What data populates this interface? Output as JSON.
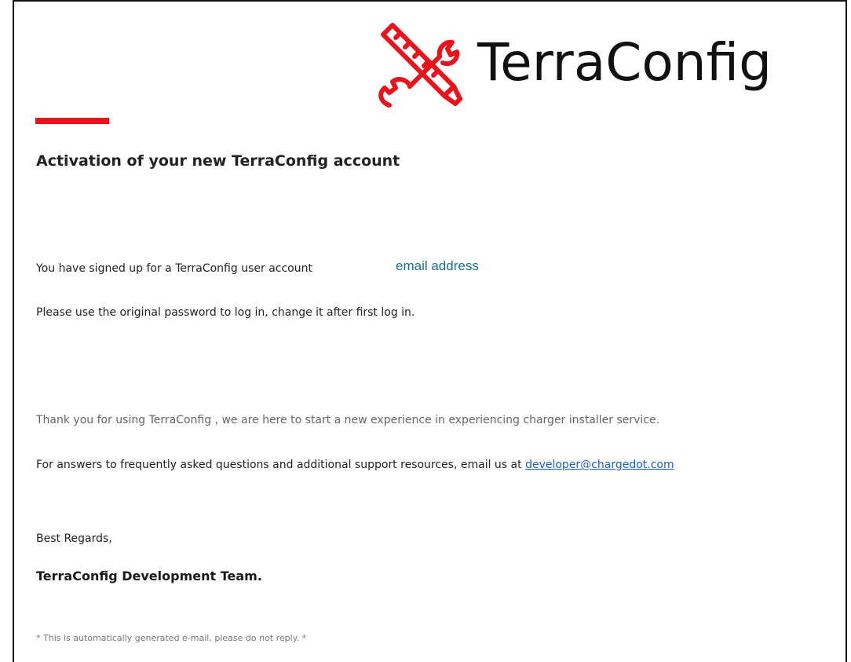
{
  "brand": {
    "name": "TerraConfig",
    "logo_icon": "crossed-tools-icon",
    "accent_color": "#e8141c"
  },
  "email": {
    "title": "Activation of your new TerraConfig account",
    "signup_text": "You have signed up for a TerraConfig user account",
    "email_placeholder": "email address",
    "password_text": "Please use the original password to log in, change it after first log in.",
    "thanks_text": "Thank you for using TerraConfig , we are here to start a new experience in experiencing charger installer service.",
    "support_text": "For answers to frequently asked questions and additional support resources, email us at",
    "support_email": "developer@chargedot.com",
    "regards": "Best Regards,",
    "signoff": "TerraConfig Development Team.",
    "footer_note": "* This is automatically generated e-mail, please do not reply. *"
  },
  "colors": {
    "placeholder_color": "#1a6f8c",
    "link_color": "#1f5fc0"
  }
}
